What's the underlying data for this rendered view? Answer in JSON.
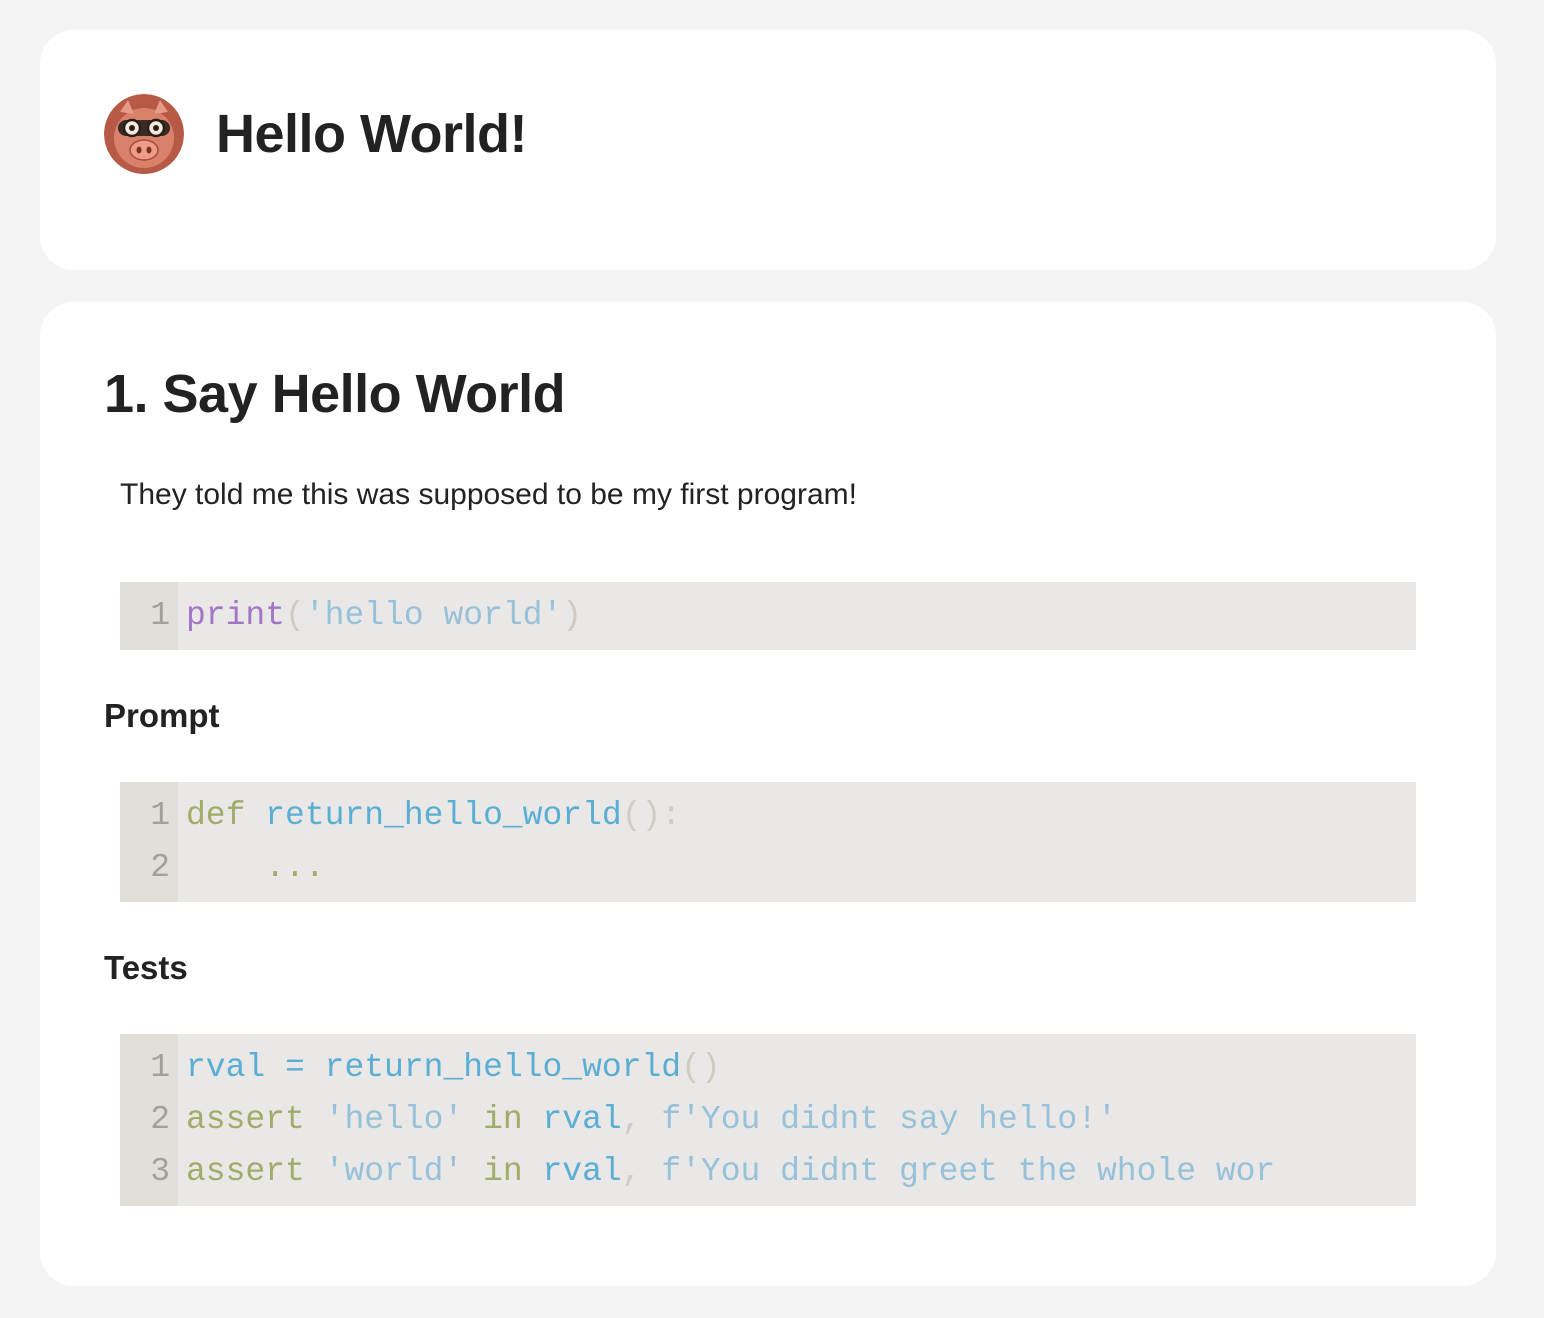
{
  "header": {
    "title": "Hello World!",
    "avatar_icon": "pig-avatar-icon"
  },
  "section": {
    "title": "1. Say Hello World",
    "description": "They told me this was supposed to be my first program!",
    "example_code": {
      "lines": [
        {
          "num": "1",
          "tokens": [
            {
              "t": "print",
              "c": "kw-purple"
            },
            {
              "t": "(",
              "c": "punct"
            },
            {
              "t": "'hello world'",
              "c": "str"
            },
            {
              "t": ")",
              "c": "punct"
            }
          ]
        }
      ]
    },
    "prompt_heading": "Prompt",
    "prompt_code": {
      "lines": [
        {
          "num": "1",
          "tokens": [
            {
              "t": "def",
              "c": "kw-green"
            },
            {
              "t": " ",
              "c": ""
            },
            {
              "t": "return_hello_world",
              "c": "ident"
            },
            {
              "t": "():",
              "c": "punct"
            }
          ]
        },
        {
          "num": "2",
          "tokens": [
            {
              "t": "    ",
              "c": ""
            },
            {
              "t": "...",
              "c": "kw-green"
            }
          ]
        }
      ]
    },
    "tests_heading": "Tests",
    "tests_code": {
      "lines": [
        {
          "num": "1",
          "tokens": [
            {
              "t": "rval",
              "c": "ident"
            },
            {
              "t": " = ",
              "c": "op"
            },
            {
              "t": "return_hello_world",
              "c": "ident"
            },
            {
              "t": "()",
              "c": "punct"
            }
          ]
        },
        {
          "num": "2",
          "tokens": [
            {
              "t": "assert",
              "c": "kw-green"
            },
            {
              "t": " ",
              "c": ""
            },
            {
              "t": "'hello'",
              "c": "str"
            },
            {
              "t": " ",
              "c": ""
            },
            {
              "t": "in",
              "c": "kw-green"
            },
            {
              "t": " ",
              "c": ""
            },
            {
              "t": "rval",
              "c": "ident"
            },
            {
              "t": ", ",
              "c": "punct"
            },
            {
              "t": "f'You didnt say hello!'",
              "c": "str"
            }
          ]
        },
        {
          "num": "3",
          "tokens": [
            {
              "t": "assert",
              "c": "kw-green"
            },
            {
              "t": " ",
              "c": ""
            },
            {
              "t": "'world'",
              "c": "str"
            },
            {
              "t": " ",
              "c": ""
            },
            {
              "t": "in",
              "c": "kw-green"
            },
            {
              "t": " ",
              "c": ""
            },
            {
              "t": "rval",
              "c": "ident"
            },
            {
              "t": ", ",
              "c": "punct"
            },
            {
              "t": "f'You didnt greet the whole wor",
              "c": "str"
            }
          ]
        }
      ]
    }
  }
}
